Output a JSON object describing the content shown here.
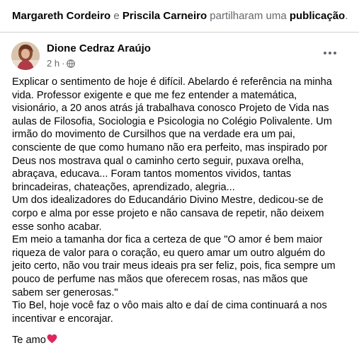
{
  "share_header": {
    "user1": "Margareth Cordeiro",
    "conjunction": "e",
    "user2": "Priscila Carneiro",
    "action": "partilharam uma",
    "object": "publicação",
    "period": "."
  },
  "post": {
    "author": "Dione Cedraz Araújo",
    "time": "2 h",
    "separator": "·",
    "privacy_icon": "globe-icon",
    "more_icon": "more-options-icon",
    "lines": [
      "Explicar o sentimento de hoje é difícil. Abelardo é referência na minha",
      "vida. Professor exigente e que me fez entender a matemática,",
      "visionário, a 20 anos atrás já trabalhava conosco Projeto de Vida nas",
      "aulas de Filosofia, Sociologia e Psicologia no Colégio Polivalente. Um",
      "irmão do movimento de Cursilhos que na verdade era um pai,",
      "consciente de que como humano não era perfeito, mas inspirado por",
      "Deus nos mostrava qual o caminho certo seguir, puxava orelha,",
      "abraçava, educava... Foram tantos momentos vividos, tantas",
      "brincadeiras, chateações, aprendizado, alegria...",
      "Um dos idealizadores do Educandário Divino Mestre, dedicou-se de",
      "corpo e alma por esse projeto e não cansava de repetir, não deixem",
      "esse sonho acabar.",
      "Em meio a tamanha dor fica a certeza de que \"O amor é bem maior",
      "riqueza de valor para o coração, eu quero amar um outro alguém do",
      "jeito certo, não vou trair meus ideais pra ser feliz, pois, fica sempre um",
      "pouco de perfume nas mãos que oferecem rosas, nas mãos que",
      "sabem ser generosas.\"",
      "Tio Bel, hoje você faz o vôo mais alto e daí de cima continuará a nos",
      "incentivar e encorajar."
    ],
    "closing": "Te amo",
    "closing_emoji": "heart-emoji",
    "heart_color": "#e0245e"
  },
  "colors": {
    "text": "#050505",
    "muted": "#65676b",
    "background": "#ffffff"
  }
}
